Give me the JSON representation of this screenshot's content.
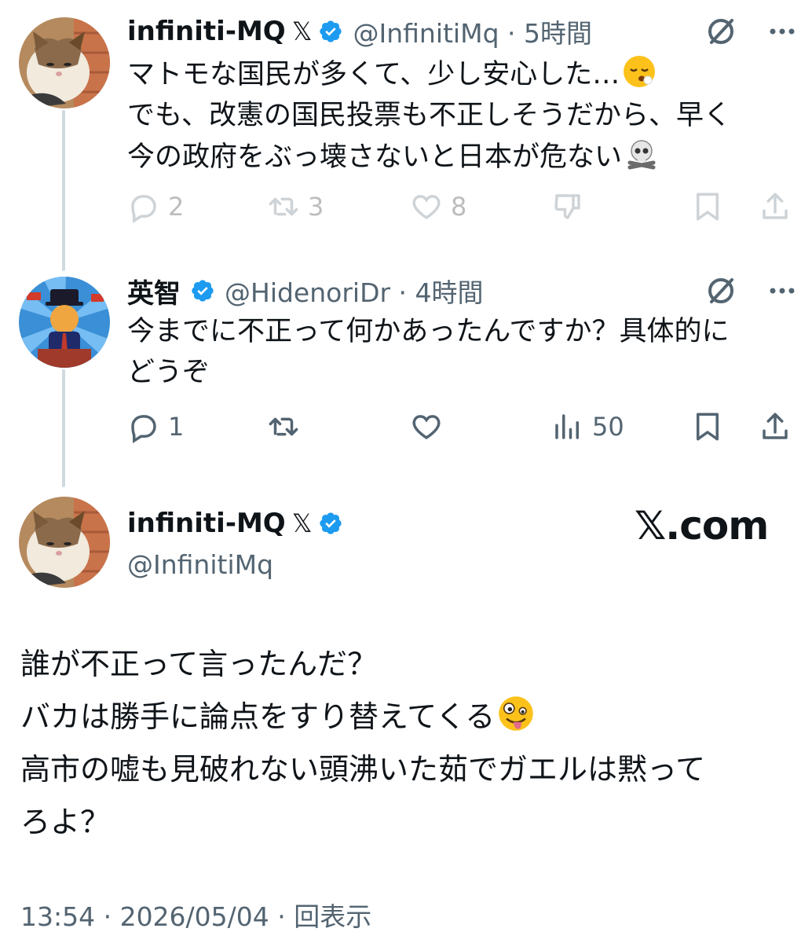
{
  "tweet1": {
    "display_name": "infiniti-MQ",
    "x_mark": "𝕏",
    "handle": "@InfinitiMq",
    "time": "5時間",
    "lines": [
      "マトモな国民が多くて、少し安心した…",
      "でも、改憲の国民投票も不正しそうだから、早く",
      "今の政府をぶっ壊さないと日本が危ない"
    ],
    "emojis": [
      "relieved-face",
      "skull-and-crossbones"
    ],
    "reply_count": "2",
    "repost_count": "3",
    "like_count": "8"
  },
  "tweet2": {
    "display_name": "英智",
    "handle": "@HidenoriDr",
    "time": "4時間",
    "lines": [
      "今までに不正って何かあったんですか？具体的に",
      "どうぞ"
    ],
    "reply_count": "1",
    "views_count": "50"
  },
  "tweet3": {
    "display_name": "infiniti-MQ",
    "x_mark": "𝕏",
    "handle": "@InfinitiMq",
    "watermark": "𝕏.com",
    "lines": [
      "誰が不正って言ったんだ？",
      "バカは勝手に論点をすり替えてくる",
      "高市の嘘も見破れない頭沸いた茹でガエルは黙って",
      "ろよ？"
    ],
    "emojis": [
      "zany-face"
    ],
    "timestamp": "13:54 · 2026/05/04 · ",
    "views_label": "回表示"
  },
  "colors": {
    "verified_blue": "#1d9bf0",
    "secondary_text": "#536471",
    "thread_line": "#cfd9de"
  }
}
